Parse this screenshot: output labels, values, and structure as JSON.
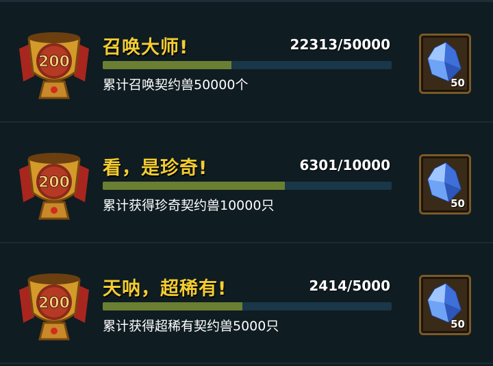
{
  "achievements": [
    {
      "badge_value": "200",
      "title": "召唤大师!",
      "progress_text": "22313/50000",
      "progress": 0.446,
      "description": "累计召唤契约兽50000个",
      "reward_icon": "blue-crystal-icon",
      "reward_qty": "50"
    },
    {
      "badge_value": "200",
      "title": "看，是珍奇!",
      "progress_text": "6301/10000",
      "progress": 0.63,
      "description": "累计获得珍奇契约兽10000只",
      "reward_icon": "blue-crystal-icon",
      "reward_qty": "50"
    },
    {
      "badge_value": "200",
      "title": "天呐，超稀有!",
      "progress_text": "2414/5000",
      "progress": 0.483,
      "description": "累计获得超稀有契约兽5000只",
      "reward_icon": "blue-crystal-icon",
      "reward_qty": "50"
    }
  ],
  "colors": {
    "title": "#f2cc33",
    "progress_fill": "#6a7f32",
    "progress_track": "#193748",
    "background": "#0f1c22"
  }
}
